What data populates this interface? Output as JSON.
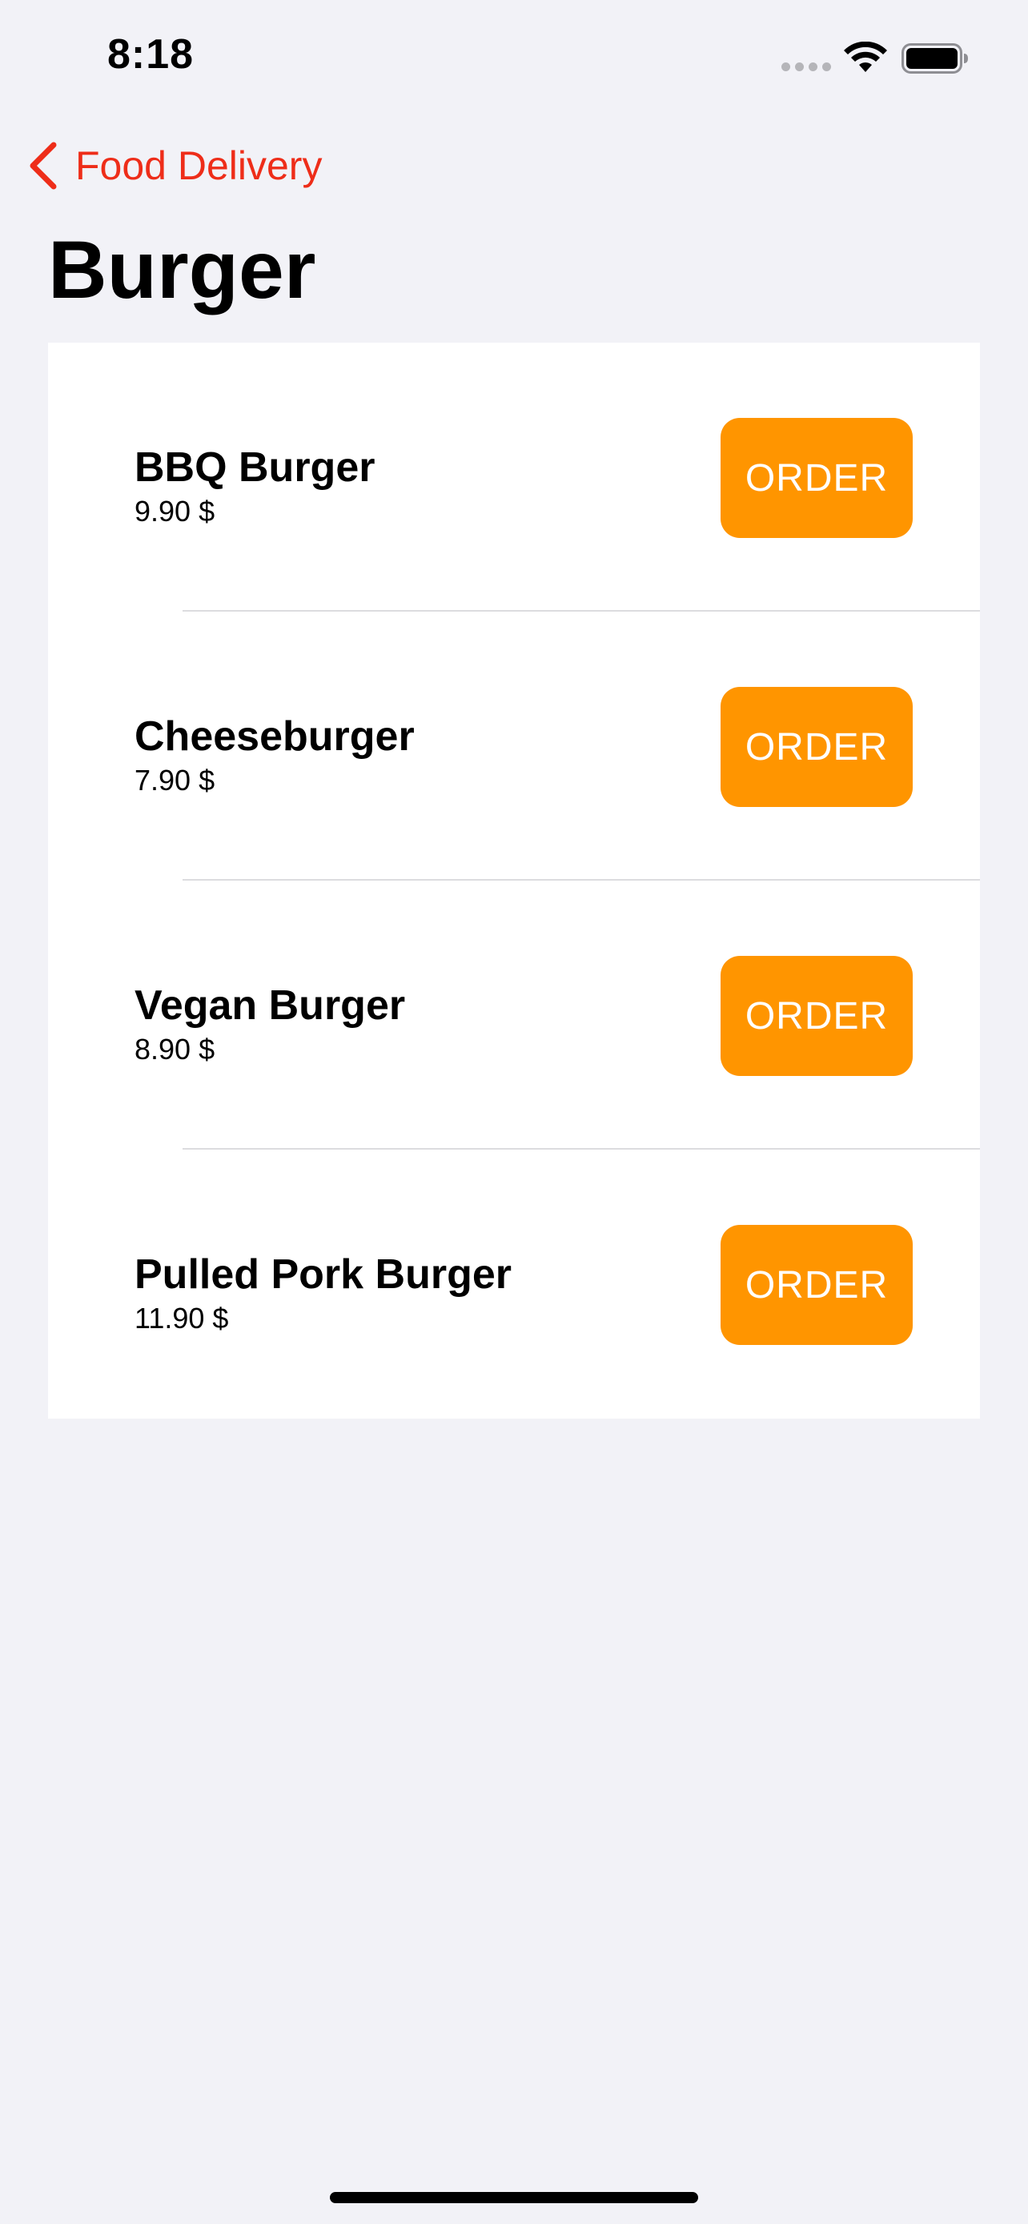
{
  "status_bar": {
    "time": "8:18"
  },
  "nav": {
    "back_label": "Food Delivery",
    "title": "Burger"
  },
  "colors": {
    "accent": "#ee2d19",
    "button": "#ff9500",
    "background": "#f2f2f7",
    "card": "#ffffff"
  },
  "icons": {
    "back": "chevron-left-icon",
    "signal": "signal-dots-icon",
    "wifi": "wifi-icon",
    "battery": "battery-icon"
  },
  "menu": {
    "items": [
      {
        "name": "BBQ Burger",
        "price": "9.90 $",
        "button_label": "ORDER"
      },
      {
        "name": "Cheeseburger",
        "price": "7.90 $",
        "button_label": "ORDER"
      },
      {
        "name": "Vegan Burger",
        "price": "8.90 $",
        "button_label": "ORDER"
      },
      {
        "name": "Pulled Pork Burger",
        "price": "11.90 $",
        "button_label": "ORDER"
      }
    ]
  }
}
